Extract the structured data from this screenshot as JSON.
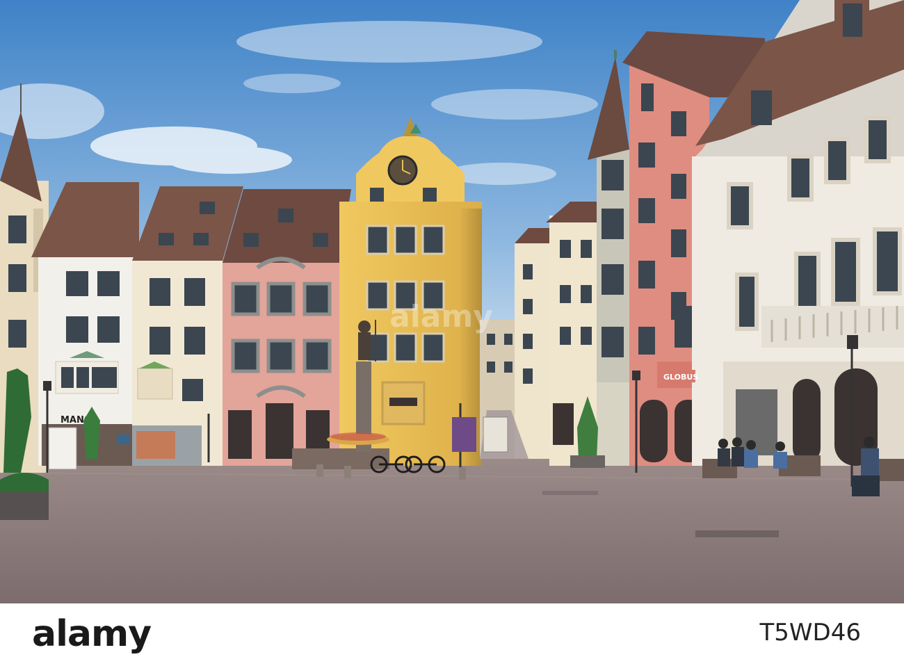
{
  "scene": {
    "signs": {
      "manor": "MANOR",
      "globus": "GLOBUS"
    },
    "colors": {
      "sky_top": "#4f8fcf",
      "sky_bottom": "#c9dcef",
      "cobblestone": "#8e7f80",
      "yellow_building": "#e8c15a",
      "pink_building": "#e3a49a",
      "salmon_building": "#df8d80",
      "cream_building": "#f1e8d4",
      "white_building": "#f2f0ea",
      "roof": "#7a5548"
    }
  },
  "watermark": {
    "logo": "alamy",
    "image_id": "T5WD46",
    "overlay_text": "alamy"
  }
}
